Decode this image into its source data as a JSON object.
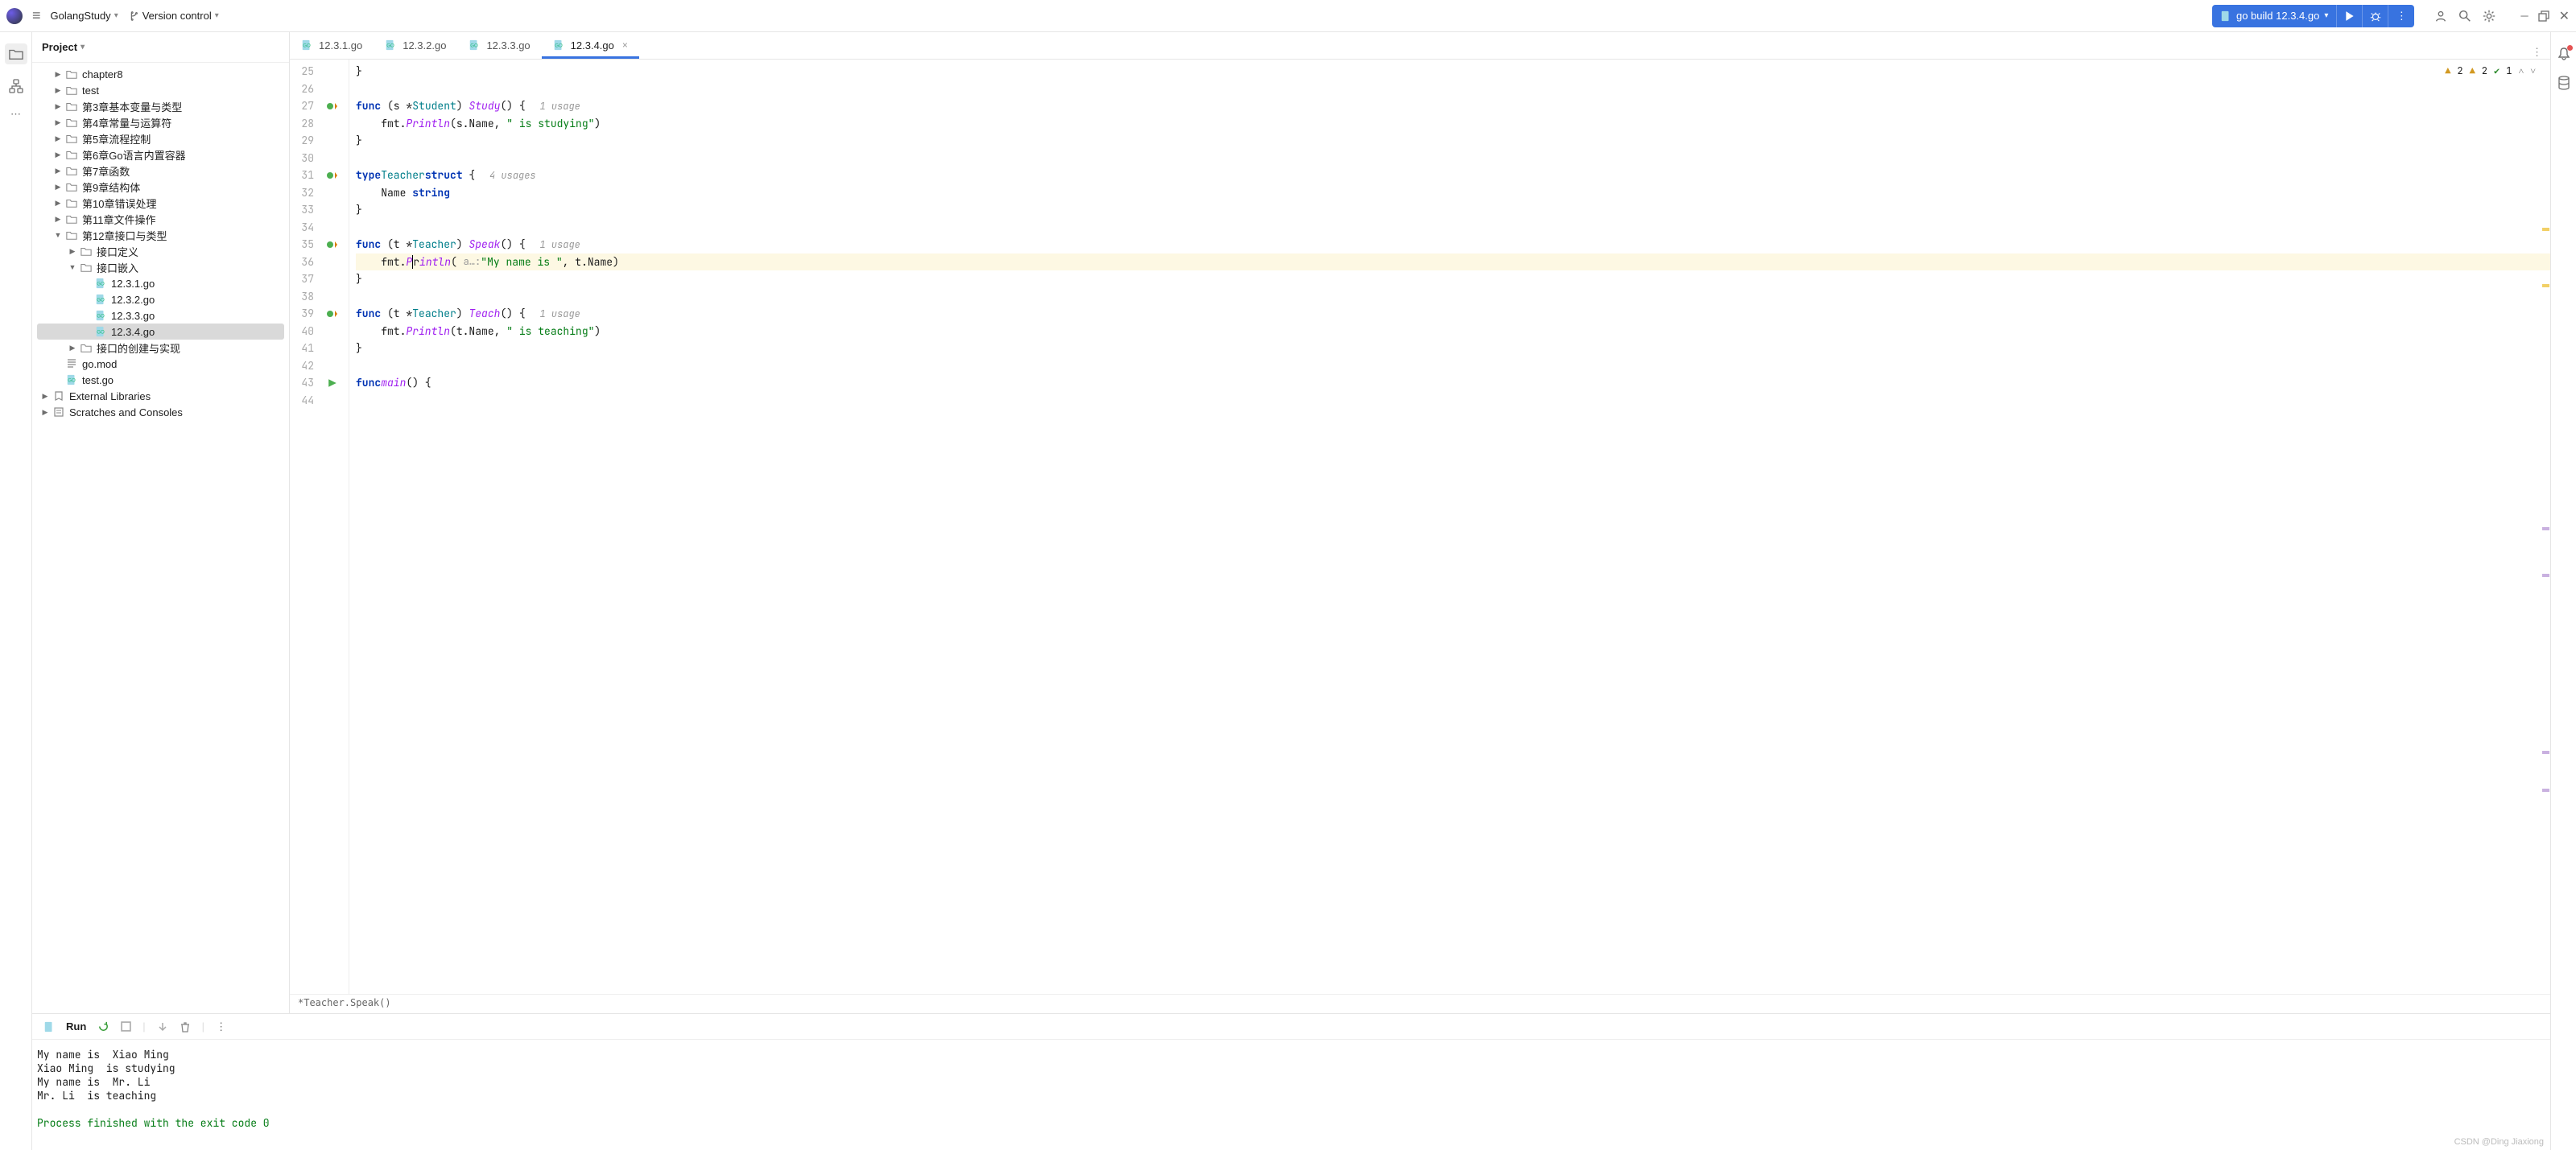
{
  "top": {
    "project": "GolangStudy",
    "version_control": "Version control",
    "run_config": "go build 12.3.4.go"
  },
  "sidebar": {
    "title": "Project",
    "items": [
      {
        "indent": 0,
        "tw": "▶",
        "icon": "folder",
        "label": "chapter8"
      },
      {
        "indent": 0,
        "tw": "▶",
        "icon": "folder",
        "label": "test"
      },
      {
        "indent": 0,
        "tw": "▶",
        "icon": "folder",
        "label": "第3章基本变量与类型"
      },
      {
        "indent": 0,
        "tw": "▶",
        "icon": "folder",
        "label": "第4章常量与运算符"
      },
      {
        "indent": 0,
        "tw": "▶",
        "icon": "folder",
        "label": "第5章流程控制"
      },
      {
        "indent": 0,
        "tw": "▶",
        "icon": "folder",
        "label": "第6章Go语言内置容器"
      },
      {
        "indent": 0,
        "tw": "▶",
        "icon": "folder",
        "label": "第7章函数"
      },
      {
        "indent": 0,
        "tw": "▶",
        "icon": "folder",
        "label": "第9章结构体"
      },
      {
        "indent": 0,
        "tw": "▶",
        "icon": "folder",
        "label": "第10章错误处理"
      },
      {
        "indent": 0,
        "tw": "▶",
        "icon": "folder",
        "label": "第11章文件操作"
      },
      {
        "indent": 0,
        "tw": "▼",
        "icon": "folder",
        "label": "第12章接口与类型"
      },
      {
        "indent": 1,
        "tw": "▶",
        "icon": "folder",
        "label": "接口定义"
      },
      {
        "indent": 1,
        "tw": "▼",
        "icon": "folder",
        "label": "接口嵌入"
      },
      {
        "indent": 2,
        "tw": "",
        "icon": "go",
        "label": "12.3.1.go"
      },
      {
        "indent": 2,
        "tw": "",
        "icon": "go",
        "label": "12.3.2.go"
      },
      {
        "indent": 2,
        "tw": "",
        "icon": "go",
        "label": "12.3.3.go"
      },
      {
        "indent": 2,
        "tw": "",
        "icon": "go",
        "label": "12.3.4.go",
        "selected": true
      },
      {
        "indent": 1,
        "tw": "▶",
        "icon": "folder",
        "label": "接口的创建与实现"
      },
      {
        "indent": 0,
        "tw": "",
        "icon": "mod",
        "label": "go.mod"
      },
      {
        "indent": 0,
        "tw": "",
        "icon": "go",
        "label": "test.go"
      }
    ],
    "ext_lib": "External Libraries",
    "scratch": "Scratches and Consoles"
  },
  "tabs": [
    "12.3.1.go",
    "12.3.2.go",
    "12.3.3.go",
    "12.3.4.go"
  ],
  "active_tab": 3,
  "gutter_start": 25,
  "inspection": {
    "warn1": "2",
    "warn2": "2",
    "ok": "1"
  },
  "breadcrumb": "*Teacher.Speak()",
  "run": {
    "label": "Run",
    "output": [
      "My name is  Xiao Ming",
      "Xiao Ming  is studying",
      "My name is  Mr. Li",
      "Mr. Li  is teaching",
      ""
    ],
    "exit": "Process finished with the exit code 0"
  },
  "watermark": "CSDN @Ding Jiaxiong",
  "code": {
    "l27_usage": "1 usage",
    "l31_usage": "4 usages",
    "l35_usage": "1 usage",
    "l39_usage": "1 usage",
    "l36_hint": "a…:",
    "s_study": "\" is studying\"",
    "s_name": "\"My name is \"",
    "s_teach": "\" is teaching\""
  }
}
